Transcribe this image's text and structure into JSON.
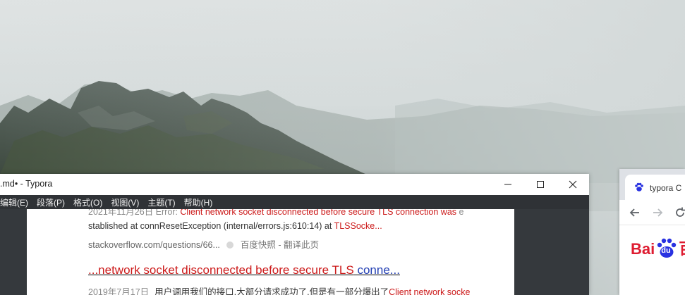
{
  "typora": {
    "title": ".md• - Typora",
    "menu": [
      "编辑(E)",
      "段落(P)",
      "格式(O)",
      "视图(V)",
      "主题(T)",
      "帮助(H)"
    ],
    "content": {
      "clipped_prefix": "2021年11月26日 Error: ",
      "clipped_red": "Client network socket disconnected before secure TLS connection was",
      "clipped_suffix": " e",
      "line2_text": "stablished at connResetException (internal/errors.js:610:14) at ",
      "line2_red": "TLSSocke...",
      "line3_url": "stackoverflow.com/questions/66...",
      "line3_snapshot": "百度快照",
      "line3_translate": " - 翻译此页",
      "result_title_red": "...network socket disconnected before secure TLS",
      "result_title_blue": " conne...",
      "line5_date": "2019年7月17日",
      "line5_text": "用户调用我们的接口,大部分请求成功了,但是有一部分爆出了",
      "line5_red": "Client network socke"
    }
  },
  "browser": {
    "tab_title": "typora C",
    "logo_left": "Bai",
    "logo_paw_text": "du",
    "logo_right": "百",
    "brand_color": "#de1c31",
    "favicon": "baidu-paw-icon"
  },
  "colors": {
    "menu_bg": "#2f3236",
    "editor_bg": "#35393d",
    "link_red": "#cc1a1a",
    "link_blue": "#2440b3"
  }
}
